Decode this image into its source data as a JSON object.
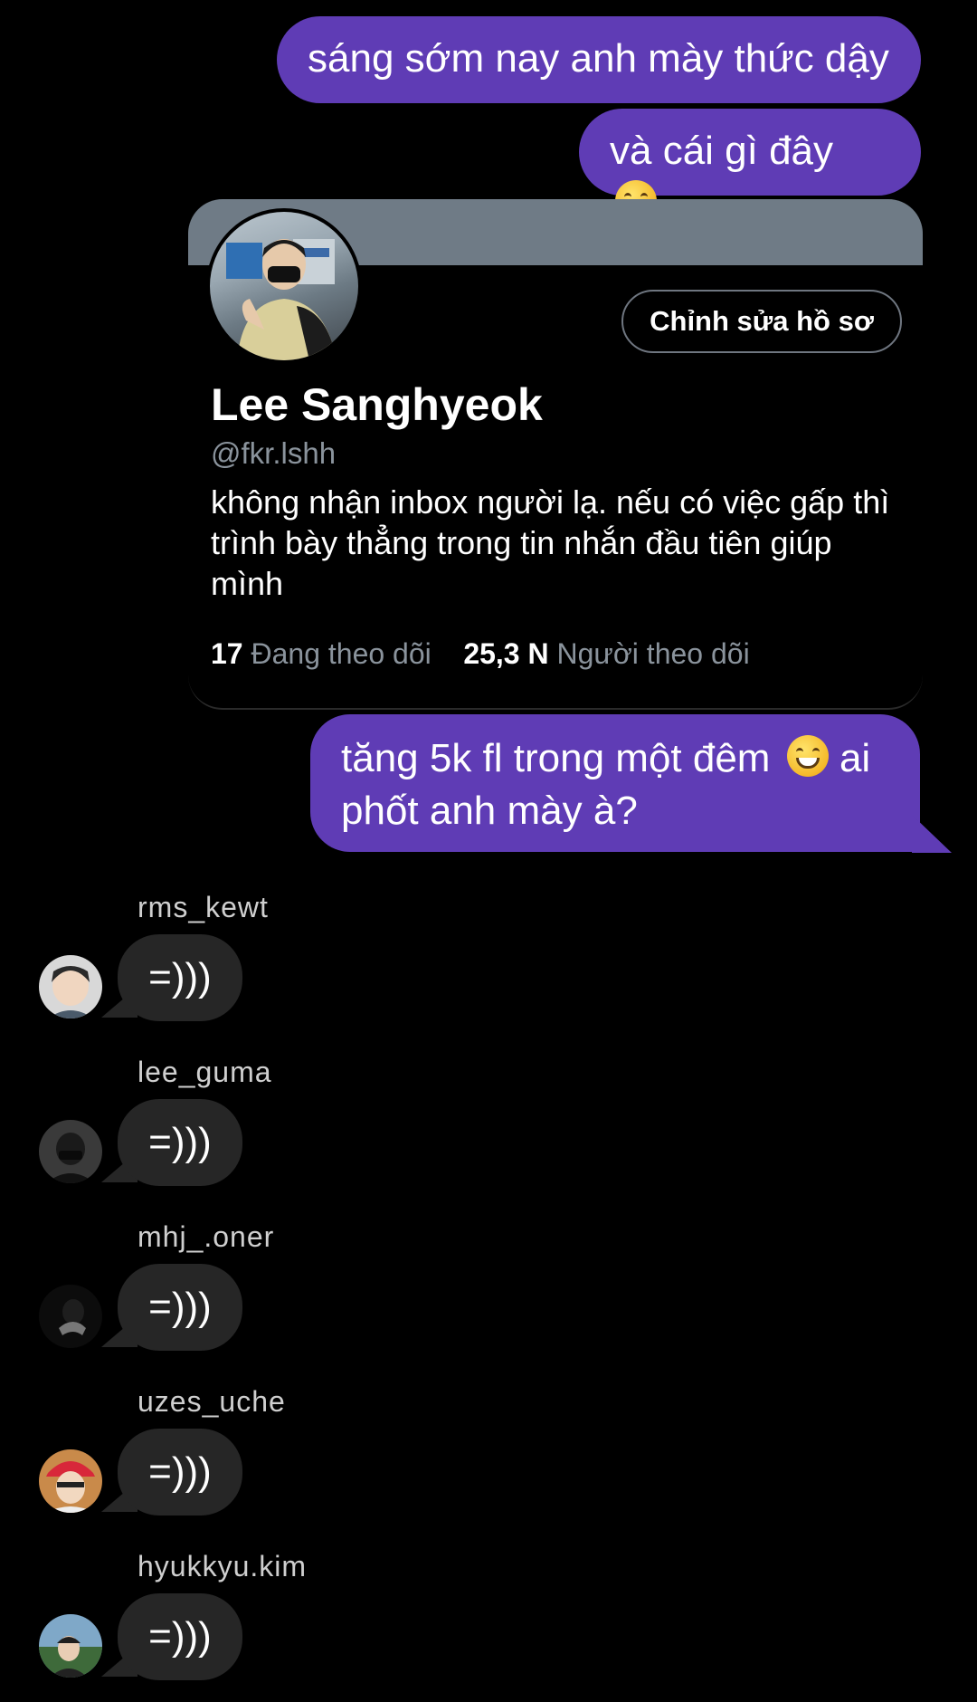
{
  "outgoing": [
    "sáng sớm nay anh mày thức dậy",
    "và cái gì đây",
    "tăng 5k fl trong một đêm",
    "ai phốt anh mày à?"
  ],
  "profile": {
    "name": "Lee Sanghyeok",
    "handle": "@fkr.lshh",
    "bio": "không nhận inbox người lạ. nếu có việc gấp thì trình bày thẳng trong tin nhắn đầu tiên giúp mình",
    "edit_button": "Chỉnh sửa hồ sơ",
    "following_count": "17",
    "following_label": "Đang theo dõi",
    "followers_count": "25,3 N",
    "followers_label": "Người theo dõi"
  },
  "incoming": [
    {
      "sender": "rms_kewt",
      "text": "=)))"
    },
    {
      "sender": "lee_guma",
      "text": "=)))"
    },
    {
      "sender": "mhj_.oner",
      "text": "=)))"
    },
    {
      "sender": "uzes_uche",
      "text": "=)))"
    },
    {
      "sender": "hyukkyu.kim",
      "text": "=)))"
    }
  ],
  "colors": {
    "outgoing_bubble": "#5f3cb5",
    "incoming_bubble": "#262626",
    "banner": "#6f7b86"
  }
}
